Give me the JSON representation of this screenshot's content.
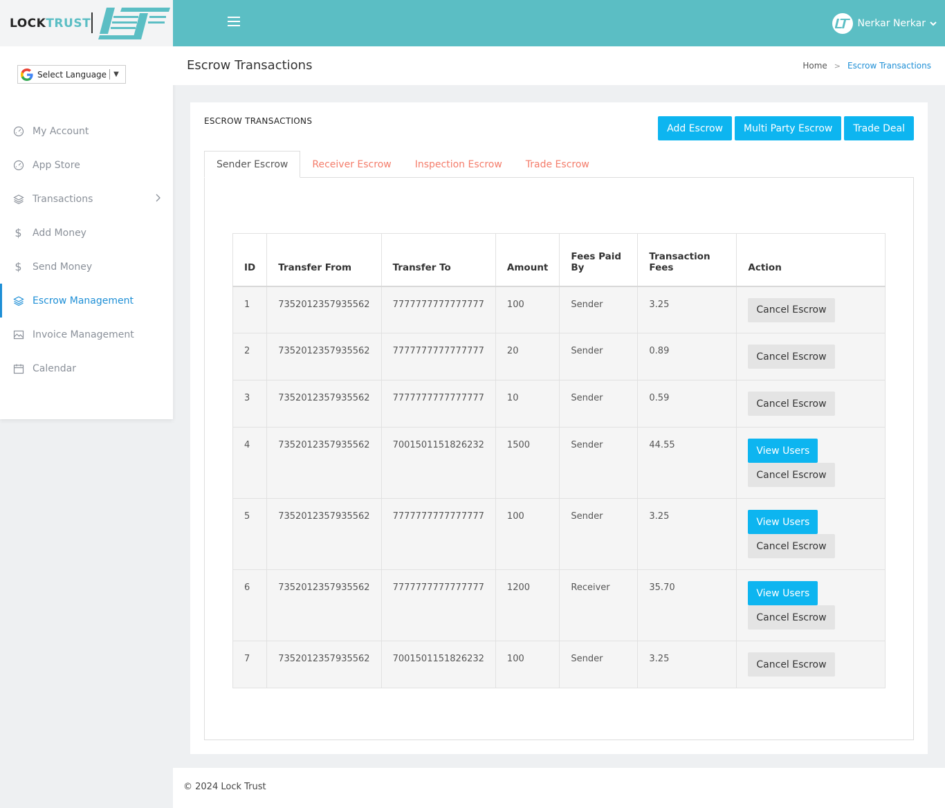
{
  "brand": {
    "part1": "LOCK",
    "part2": "TRUST",
    "color": "#5bbec4"
  },
  "language": {
    "label": "Select Language"
  },
  "sidebar": {
    "items": [
      {
        "label": "My Account",
        "icon": "speedometer-icon"
      },
      {
        "label": "App Store",
        "icon": "speedometer-icon"
      },
      {
        "label": "Transactions",
        "icon": "layers-icon"
      },
      {
        "label": "Add Money",
        "icon": "dollar-icon"
      },
      {
        "label": "Send Money",
        "icon": "dollar-icon"
      },
      {
        "label": "Escrow Management",
        "icon": "layers-icon"
      },
      {
        "label": "Invoice Management",
        "icon": "image-icon"
      },
      {
        "label": "Calendar",
        "icon": "calendar-icon"
      }
    ]
  },
  "user": {
    "name": "Nerkar Nerkar"
  },
  "header": {
    "title": "Escrow Transactions",
    "breadcrumb_home": "Home",
    "breadcrumb_current": "Escrow Transactions"
  },
  "card": {
    "title": "ESCROW TRANSACTIONS",
    "buttons": {
      "add": "Add Escrow",
      "multi": "Multi Party Escrow",
      "trade": "Trade Deal"
    },
    "tabs": [
      "Sender Escrow",
      "Receiver Escrow",
      "Inspection Escrow",
      "Trade Escrow"
    ]
  },
  "table": {
    "headers": {
      "id": "ID",
      "from": "Transfer From",
      "to": "Transfer To",
      "amount": "Amount",
      "fees_by": "Fees Paid By",
      "fees": "Transaction Fees",
      "action": "Action"
    },
    "view_label": "View Users",
    "cancel_label": "Cancel Escrow",
    "rows": [
      {
        "id": "1",
        "from": "7352012357935562",
        "to": "7777777777777777",
        "amount": "100",
        "fees_by": "Sender",
        "fees": "3.25",
        "view": false
      },
      {
        "id": "2",
        "from": "7352012357935562",
        "to": "7777777777777777",
        "amount": "20",
        "fees_by": "Sender",
        "fees": "0.89",
        "view": false
      },
      {
        "id": "3",
        "from": "7352012357935562",
        "to": "7777777777777777",
        "amount": "10",
        "fees_by": "Sender",
        "fees": "0.59",
        "view": false
      },
      {
        "id": "4",
        "from": "7352012357935562",
        "to": "7001501151826232",
        "amount": "1500",
        "fees_by": "Sender",
        "fees": "44.55",
        "view": true
      },
      {
        "id": "5",
        "from": "7352012357935562",
        "to": "7777777777777777",
        "amount": "100",
        "fees_by": "Sender",
        "fees": "3.25",
        "view": true
      },
      {
        "id": "6",
        "from": "7352012357935562",
        "to": "7777777777777777",
        "amount": "1200",
        "fees_by": "Receiver",
        "fees": "35.70",
        "view": true
      },
      {
        "id": "7",
        "from": "7352012357935562",
        "to": "7001501151826232",
        "amount": "100",
        "fees_by": "Sender",
        "fees": "3.25",
        "view": false
      }
    ]
  },
  "footer": {
    "text": "© 2024 Lock Trust"
  }
}
